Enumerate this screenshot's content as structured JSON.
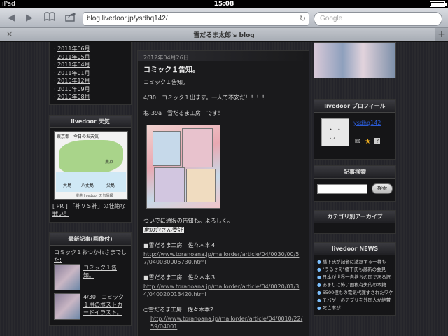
{
  "status": {
    "device": "iPad",
    "time": "15:08"
  },
  "toolbar": {
    "url": "blog.livedoor.jp/ysdhq142/",
    "search_placeholder": "Google"
  },
  "tab": {
    "title": "雪だるま太郎's blog",
    "close": "×",
    "add": "+"
  },
  "archive": [
    "2011年06月",
    "2011年05月",
    "2011年04月",
    "2011年01月",
    "2010年12月",
    "2010年09月",
    "2010年08月"
  ],
  "weather": {
    "title": "livedoor 天気",
    "image_header": "東京都　今日のお天気",
    "labels": [
      "東京",
      "大島",
      "八丈島",
      "父島"
    ],
    "footer": "提供 livedoor 天気情報",
    "pr": "[ PR ] 「神ＶＳ神」の壮絶な戦い！"
  },
  "recent": {
    "title": "最新記事(画像付)",
    "first": "コミック１おつかれさまでした!",
    "items": [
      "コミック１告知。",
      "4/30　コミック１用のポストカードイラスト。"
    ]
  },
  "post": {
    "date": "2012年04月26日",
    "title": "コミック１告知。",
    "line1": "コミック１告知。",
    "line2": "4/30　コミック１出ます。一人で不安だ！！！！",
    "line3": "ね-39a　雪だるま工房　です！",
    "line4": "ついでに通販の告知も。よろしく。",
    "hidden": "虎の穴さん委託",
    "items": [
      {
        "label": "■雪だるま工房　佐々木本４",
        "url": "http://www.toranoana.jp/mailorder/article/04/0030/00/57/040030005730.html"
      },
      {
        "label": "■雪だるま工房　佐々木本３",
        "url": "http://www.toranoana.jp/mailorder/article/04/0020/01/34/040020013420.html"
      },
      {
        "label": "○雪だるま工房　佐々木本2",
        "url": "http://www.toranoana.jp/mailorder/article/04/0010/22/59/04001"
      }
    ]
  },
  "profile": {
    "title": "livedoor プロフィール",
    "username": "ysdhq142"
  },
  "search": {
    "title": "記事検索",
    "button": "検索"
  },
  "category": {
    "title": "カテゴリ別アーカイブ"
  },
  "news": {
    "title": "livedoor NEWS",
    "items": [
      "橋下氏が記者に激怒する一幕も",
      "\"うるせえ\"橋下氏も最新の会見",
      "日本が世界一自捨ちの国である訳",
      "あまりに怖い国税有失的の本籍",
      "6500億もの電気代課すされたワケ",
      "モバゲーのアプリを外国人が絶賛",
      "死亡率が"
    ]
  }
}
